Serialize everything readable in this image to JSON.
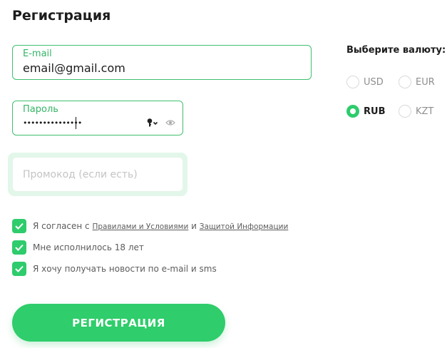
{
  "form": {
    "title": "Регистрация",
    "email": {
      "label": "E-mail",
      "value": "email@gmail.com"
    },
    "password": {
      "label": "Пароль",
      "value": "•••••••••••••••"
    },
    "promo": {
      "placeholder": "Промокод (если есть)"
    }
  },
  "currency": {
    "title": "Выберите валюту:",
    "options": [
      {
        "label": "USD",
        "selected": false
      },
      {
        "label": "EUR",
        "selected": false
      },
      {
        "label": "RUB",
        "selected": true
      },
      {
        "label": "KZT",
        "selected": false
      }
    ]
  },
  "consents": {
    "terms_prefix": "Я согласен с",
    "terms_link": "Правилами и Условиями",
    "terms_and": "и",
    "privacy_link": "Защитой Информации",
    "age": "Мне исполнилось 18 лет",
    "news": "Я хочу получать новости по e-mail и sms"
  },
  "register_button": "РЕГИСТРАЦИЯ",
  "colors": {
    "accent": "#2ecc6c",
    "label_green": "#35b466"
  },
  "icons": [
    "key-icon",
    "chevron-down-icon",
    "eye-icon",
    "checkmark-icon"
  ]
}
